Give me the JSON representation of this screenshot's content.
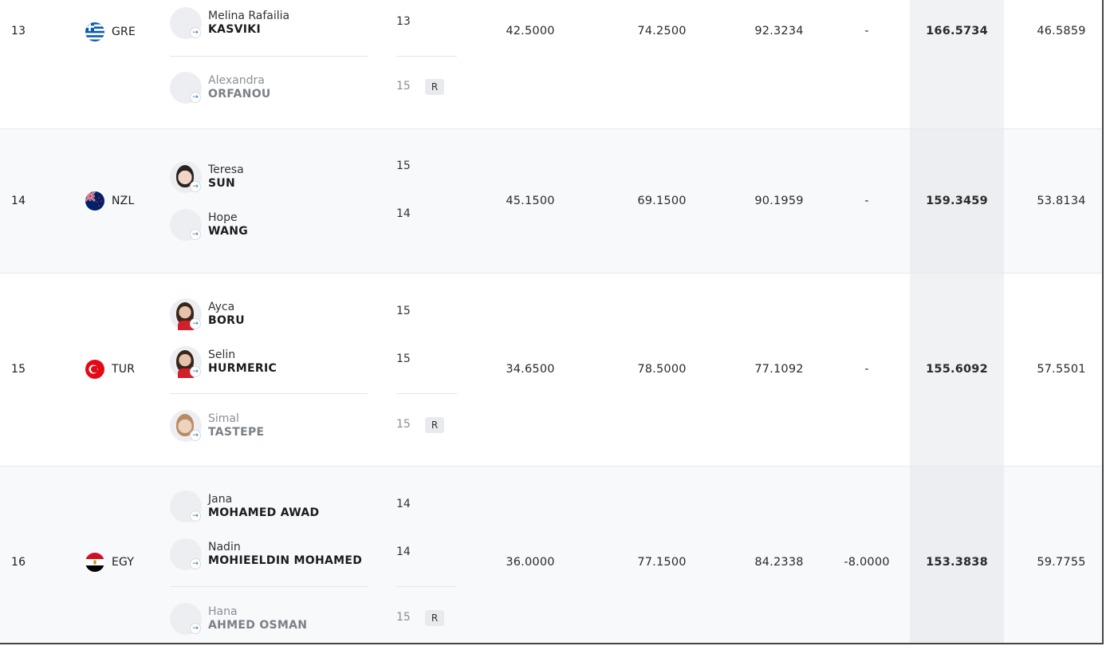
{
  "colors": {
    "row_alt": "#f7f9fb",
    "total_band": "#f0f2f4"
  },
  "rows": [
    {
      "rank": "13",
      "noc": "GRE",
      "flag": "greece-flag",
      "d": "42.5000",
      "e": "74.2500",
      "a": "92.3234",
      "pen": "-",
      "total": "166.5734",
      "gap": "46.5859",
      "athletes": [
        {
          "first": "Melina Rafailia",
          "last": "KASVIKI",
          "age": "13"
        },
        {
          "first": "Alexandra",
          "last": "ORFANOU",
          "age": "15",
          "badge": "R"
        }
      ]
    },
    {
      "rank": "14",
      "noc": "NZL",
      "flag": "new-zealand-flag",
      "d": "45.1500",
      "e": "69.1500",
      "a": "90.1959",
      "pen": "-",
      "total": "159.3459",
      "gap": "53.8134",
      "athletes": [
        {
          "first": "Teresa",
          "last": "SUN",
          "age": "15"
        },
        {
          "first": "Hope",
          "last": "WANG",
          "age": "14"
        }
      ]
    },
    {
      "rank": "15",
      "noc": "TUR",
      "flag": "turkey-flag",
      "d": "34.6500",
      "e": "78.5000",
      "a": "77.1092",
      "pen": "-",
      "total": "155.6092",
      "gap": "57.5501",
      "athletes": [
        {
          "first": "Ayca",
          "last": "BORU",
          "age": "15"
        },
        {
          "first": "Selin",
          "last": "HURMERIC",
          "age": "15"
        },
        {
          "first": "Simal",
          "last": "TASTEPE",
          "age": "15",
          "badge": "R"
        }
      ]
    },
    {
      "rank": "16",
      "noc": "EGY",
      "flag": "egypt-flag",
      "d": "36.0000",
      "e": "77.1500",
      "a": "84.2338",
      "pen": "-8.0000",
      "total": "153.3838",
      "gap": "59.7755",
      "athletes": [
        {
          "first": "Jana",
          "last": "MOHAMED AWAD",
          "age": "14"
        },
        {
          "first": "Nadin",
          "last": "MOHIEELDIN MOHAMED",
          "age": "14"
        },
        {
          "first": "Hana",
          "last": "AHMED OSMAN",
          "age": "15",
          "badge": "R"
        }
      ]
    }
  ]
}
